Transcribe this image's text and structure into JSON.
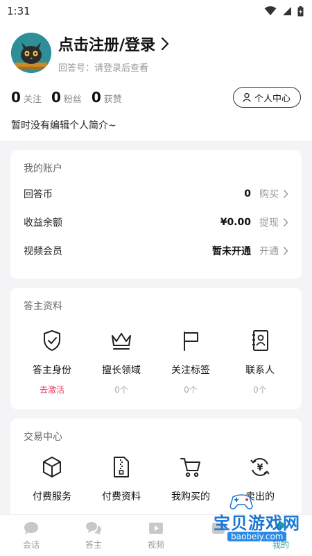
{
  "status_bar": {
    "time": "1:31"
  },
  "profile": {
    "login_title": "点击注册/登录",
    "answer_id_text": "回答号：请登录后查看"
  },
  "stats": [
    {
      "value": "0",
      "label": "关注"
    },
    {
      "value": "0",
      "label": "粉丝"
    },
    {
      "value": "0",
      "label": "获赞"
    }
  ],
  "personal_center_label": "个人中心",
  "bio": "暂时没有编辑个人简介~",
  "account": {
    "title": "我的账户",
    "rows": [
      {
        "label": "回答币",
        "value": "0",
        "action": "购买"
      },
      {
        "label": "收益余额",
        "value": "¥0.00",
        "action": "提现"
      },
      {
        "label": "视频会员",
        "value": "暂未开通",
        "action": "开通"
      }
    ]
  },
  "answerer": {
    "title": "答主资料",
    "items": [
      {
        "icon": "shield-check-icon",
        "label": "答主身份",
        "sub": "去激活"
      },
      {
        "icon": "crown-icon",
        "label": "擅长领域",
        "sub": "0个"
      },
      {
        "icon": "flag-icon",
        "label": "关注标签",
        "sub": "0个"
      },
      {
        "icon": "contact-book-icon",
        "label": "联系人",
        "sub": "0个"
      }
    ]
  },
  "trade": {
    "title": "交易中心",
    "items": [
      {
        "icon": "cube-icon",
        "label": "付费服务"
      },
      {
        "icon": "zip-file-icon",
        "label": "付费资料"
      },
      {
        "icon": "cart-icon",
        "label": "我购买的"
      },
      {
        "icon": "yen-exchange-icon",
        "label": "卖出的"
      }
    ]
  },
  "tabs": [
    {
      "icon": "chat-bubble-icon",
      "label": "会话"
    },
    {
      "icon": "chat-bubbles-icon",
      "label": "答主"
    },
    {
      "icon": "video-icon",
      "label": "视频"
    },
    {
      "icon": "tab-4-icon",
      "label": ""
    },
    {
      "icon": "person-icon",
      "label": "我的"
    }
  ],
  "watermark": {
    "text": "宝贝游戏网",
    "url": "baobeiy.com"
  },
  "colors": {
    "accent": "#1aa39a",
    "activate": "#e23a5b",
    "bg_gray": "#f4f4f6"
  }
}
